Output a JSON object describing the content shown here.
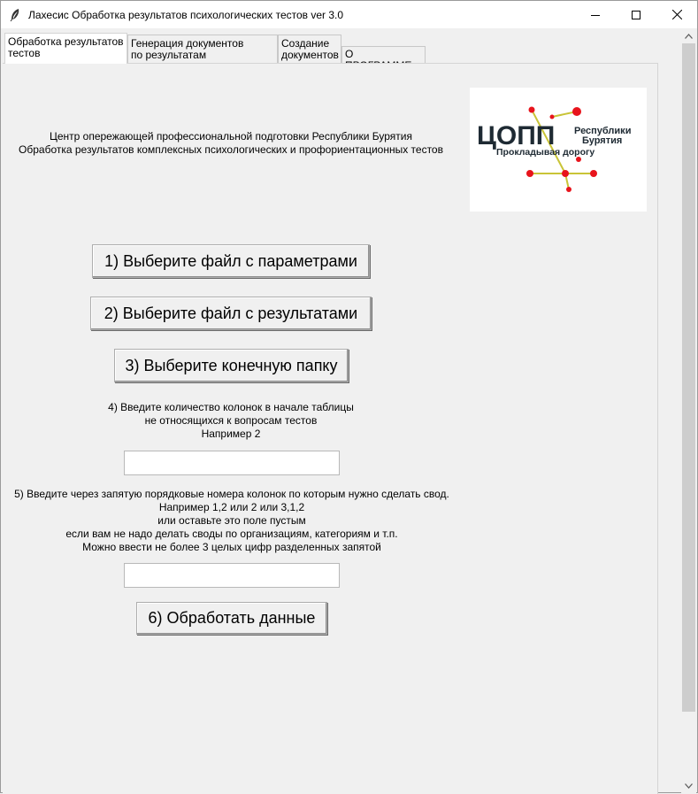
{
  "window": {
    "title": "Лахесис Обработка результатов психологических тестов ver 3.0",
    "icons": {
      "app": "feather-icon",
      "minimize": "minimize-icon",
      "maximize": "maximize-icon",
      "close": "close-icon"
    }
  },
  "tabs": [
    {
      "label": "Обработка результатов\nтестов",
      "active": true
    },
    {
      "label": "Генерация документов\nпо результатам тестирования",
      "active": false
    },
    {
      "label": "Создание\nдокументов",
      "active": false
    },
    {
      "label": "О ПРОГРАММЕ",
      "active": false
    }
  ],
  "header": {
    "org_line": "Центр опережающей профессиональной подготовки Республики Бурятия",
    "desc_line": "Обработка результатов комплексных психологических и профориентационных тестов"
  },
  "logo": {
    "main": "ЦОПП",
    "region_1": "Республики",
    "region_2": "Бурятия",
    "slogan": "Прокладывая дорогу",
    "accent_red": "#e8141c",
    "line_color": "#c9c437",
    "text_color": "#1e2a33"
  },
  "buttons": {
    "select_params": "1) Выберите файл с параметрами",
    "select_results": "2) Выберите файл с результатами",
    "select_folder": "3) Выберите конечную папку",
    "process": "6) Обработать данные"
  },
  "step4": {
    "label": "4) Введите количество колонок в начале таблицы\nне относящихся к вопросам тестов\nНапример 2",
    "value": ""
  },
  "step5": {
    "label": "5) Введите через запятую порядковые номера колонок по которым нужно сделать свод.\nНапример 1,2 или 2 или 3,1,2\nили оставьте это поле пустым\nесли вам не надо делать своды по организациям, категориям и т.п.\nМожно ввести не более 3 целых цифр разделенных запятой",
    "value": ""
  },
  "scrollbar": {
    "up_icon": "chevron-up-icon",
    "down_icon": "chevron-down-icon"
  }
}
